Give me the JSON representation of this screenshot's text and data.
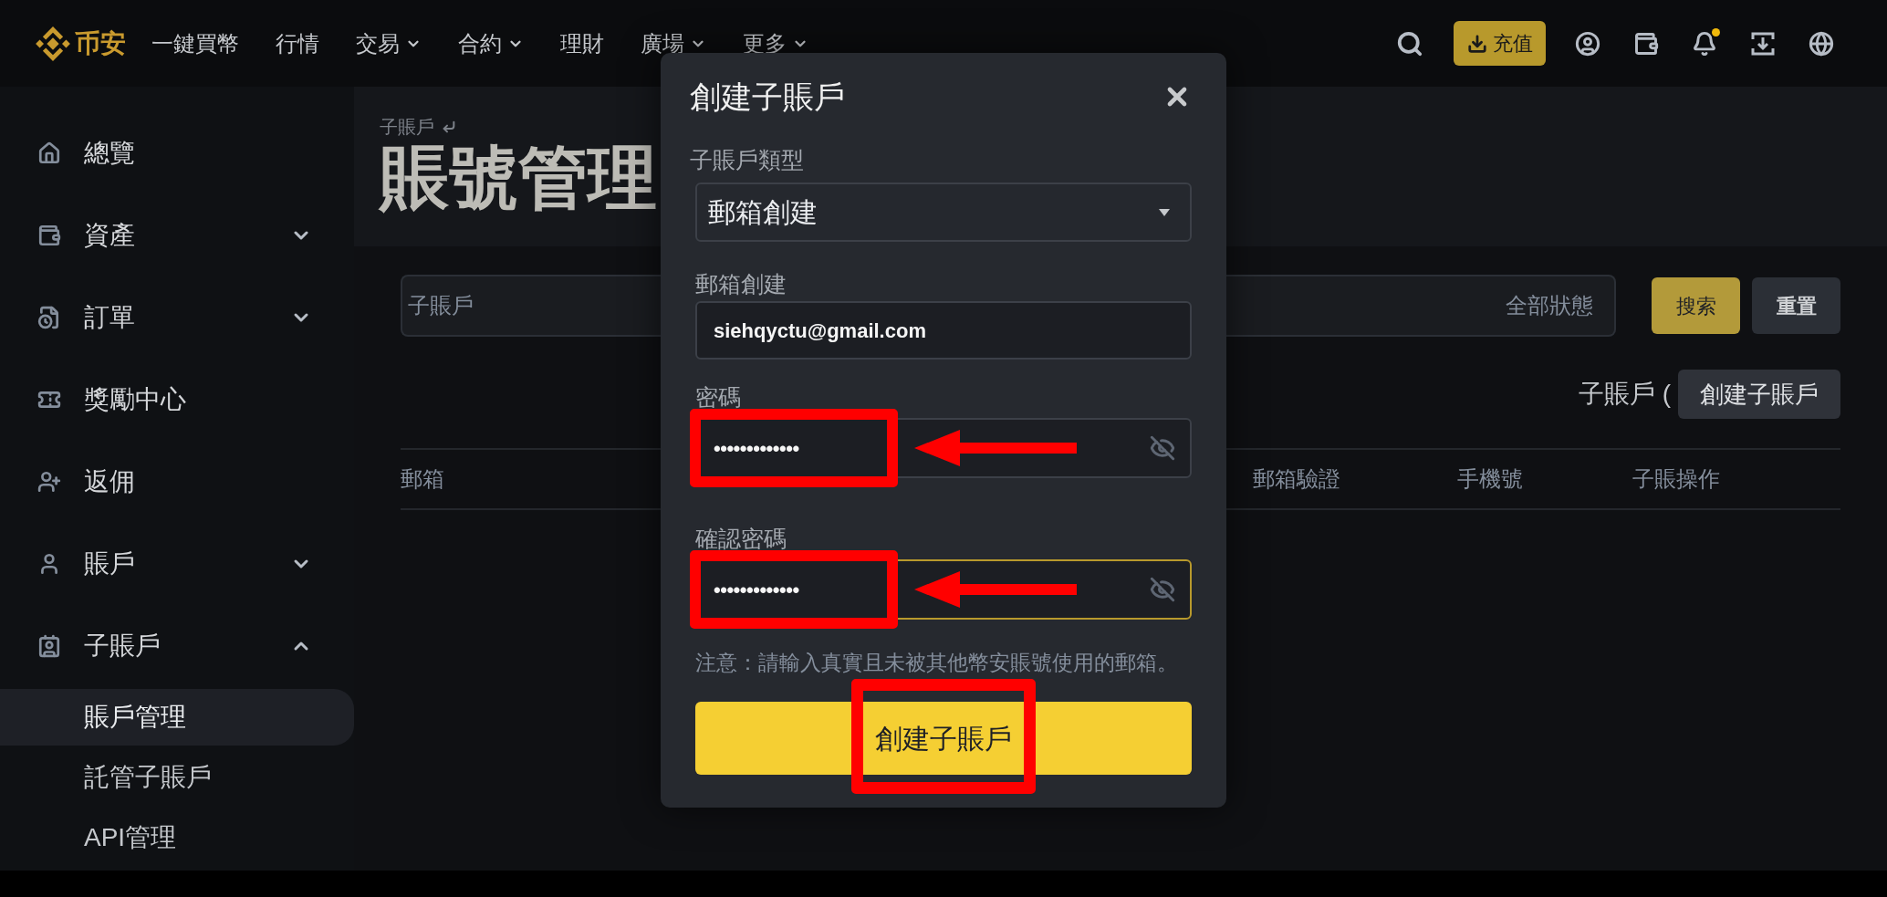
{
  "top_nav": {
    "logo_text": "币安",
    "items": [
      {
        "label": "一鍵買幣",
        "has_menu": false
      },
      {
        "label": "行情",
        "has_menu": false
      },
      {
        "label": "交易",
        "has_menu": true
      },
      {
        "label": "合約",
        "has_menu": true
      },
      {
        "label": "理財",
        "has_menu": false
      },
      {
        "label": "廣場",
        "has_menu": true
      },
      {
        "label": "更多",
        "has_menu": true
      }
    ],
    "deposit_button": "充值",
    "notifications_unread": true
  },
  "sidebar": {
    "items": [
      {
        "kind": "link",
        "label": "總覽"
      },
      {
        "kind": "group",
        "label": "資產",
        "expanded": false
      },
      {
        "kind": "group",
        "label": "訂單",
        "expanded": false
      },
      {
        "kind": "link",
        "label": "獎勵中心"
      },
      {
        "kind": "link",
        "label": "返佣"
      },
      {
        "kind": "group",
        "label": "賬戶",
        "expanded": false
      },
      {
        "kind": "group",
        "label": "子賬戶",
        "expanded": true,
        "children": [
          {
            "label": "賬戶管理",
            "selected": true
          },
          {
            "label": "託管子賬戶",
            "selected": false
          },
          {
            "label": "API管理",
            "selected": false
          }
        ]
      }
    ]
  },
  "page_header": {
    "breadcrumb": "子賬戶",
    "title": "賬號管理"
  },
  "filters": {
    "search_placeholder": "子賬戶",
    "status_placeholder": "全部狀態",
    "search_button": "搜索",
    "reset_button": "重置"
  },
  "summary": {
    "label": "子賬戶 (",
    "create_button": "創建子賬戶"
  },
  "table": {
    "columns": [
      "郵箱",
      "郵箱驗證",
      "手機號",
      "子賬操作"
    ]
  },
  "dialog": {
    "title": "創建子賬戶",
    "fields": [
      {
        "kind": "select",
        "label": "子賬戶類型",
        "value": "郵箱創建",
        "focused": false,
        "highlighted": false
      },
      {
        "kind": "text",
        "label": "郵箱創建",
        "value": "siehqyctu@gmail.com",
        "focused": false,
        "highlighted": false
      },
      {
        "kind": "password",
        "label": "密碼",
        "value": "•••••••••••••",
        "focused": false,
        "highlighted": true
      },
      {
        "kind": "password",
        "label": "確認密碼",
        "value": "•••••••••••••",
        "focused": true,
        "highlighted": true
      }
    ],
    "note": "注意：請輸入真實且未被其他幣安賬號使用的郵箱。",
    "submit": {
      "label": "創建子賬戶",
      "highlighted": true
    }
  }
}
